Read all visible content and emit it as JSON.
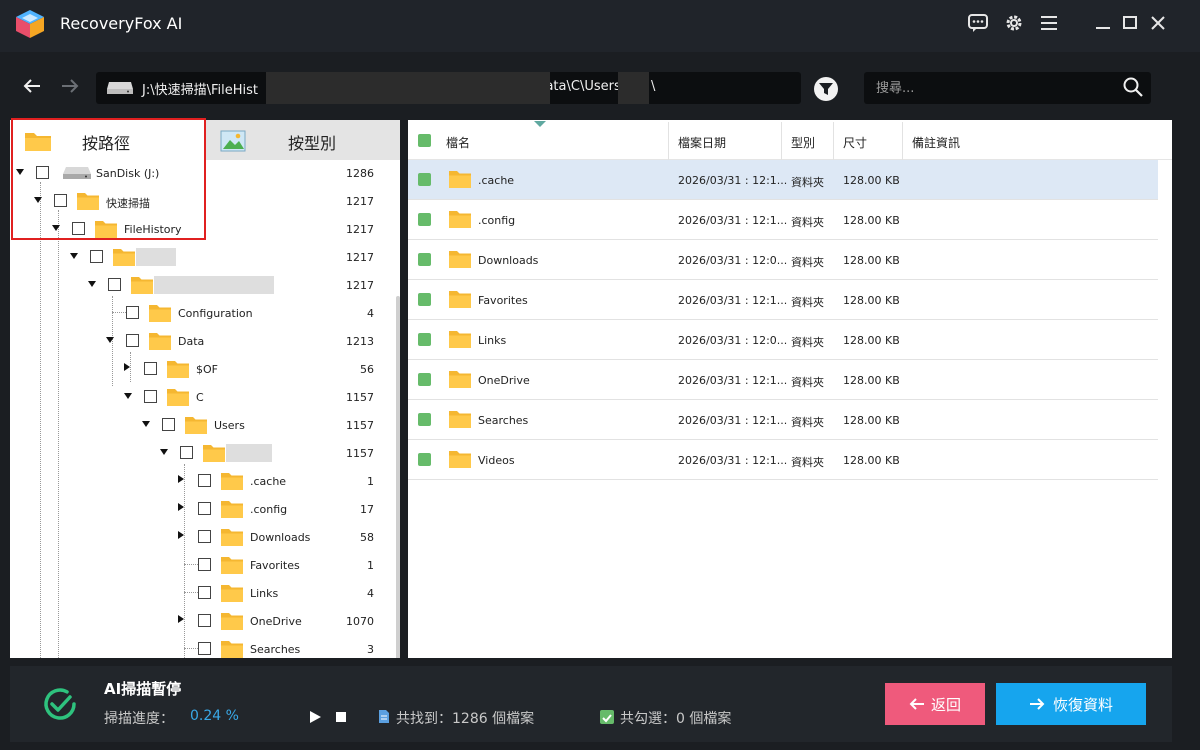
{
  "app": {
    "title": "RecoveryFox AI"
  },
  "address": {
    "path_prefix": "J:\\快速掃描\\FileHist",
    "path_suffix": ")\\Data\\C\\Users\\",
    "path_tail": "\\",
    "search_placeholder": "搜尋..."
  },
  "tabs": {
    "by_path": "按路徑",
    "by_type": "按型別"
  },
  "tree": [
    {
      "label": "SanDisk (J:)",
      "count": "1286"
    },
    {
      "label": "快速掃描",
      "count": "1217"
    },
    {
      "label": "FileHistory",
      "count": "1217"
    },
    {
      "label": "",
      "count": "1217"
    },
    {
      "label": "",
      "count": "1217"
    },
    {
      "label": "Configuration",
      "count": "4"
    },
    {
      "label": "Data",
      "count": "1213"
    },
    {
      "label": "$OF",
      "count": "56"
    },
    {
      "label": "C",
      "count": "1157"
    },
    {
      "label": "Users",
      "count": "1157"
    },
    {
      "label": "",
      "count": "1157"
    },
    {
      "label": ".cache",
      "count": "1"
    },
    {
      "label": ".config",
      "count": "17"
    },
    {
      "label": "Downloads",
      "count": "58"
    },
    {
      "label": "Favorites",
      "count": "1"
    },
    {
      "label": "Links",
      "count": "4"
    },
    {
      "label": "OneDrive",
      "count": "1070"
    },
    {
      "label": "Searches",
      "count": "3"
    }
  ],
  "table": {
    "columns": [
      "檔名",
      "檔案日期",
      "型別",
      "尺寸",
      "備註資訊"
    ],
    "rows": [
      {
        "name": ".cache",
        "date": "2026/03/31 : 12:1...",
        "type": "資料夾",
        "size": "128.00 KB"
      },
      {
        "name": ".config",
        "date": "2026/03/31 : 12:1...",
        "type": "資料夾",
        "size": "128.00 KB"
      },
      {
        "name": "Downloads",
        "date": "2026/03/31 : 12:0...",
        "type": "資料夾",
        "size": "128.00 KB"
      },
      {
        "name": "Favorites",
        "date": "2026/03/31 : 12:1...",
        "type": "資料夾",
        "size": "128.00 KB"
      },
      {
        "name": "Links",
        "date": "2026/03/31 : 12:0...",
        "type": "資料夾",
        "size": "128.00 KB"
      },
      {
        "name": "OneDrive",
        "date": "2026/03/31 : 12:1...",
        "type": "資料夾",
        "size": "128.00 KB"
      },
      {
        "name": "Searches",
        "date": "2026/03/31 : 12:1...",
        "type": "資料夾",
        "size": "128.00 KB"
      },
      {
        "name": "Videos",
        "date": "2026/03/31 : 12:1...",
        "type": "資料夾",
        "size": "128.00 KB"
      }
    ]
  },
  "status": {
    "title": "AI掃描暫停",
    "progress_label": "掃描進度：",
    "progress_value": "0.24 %",
    "found": "共找到：1286 個檔案",
    "checked": "共勾選：0 個檔案"
  },
  "buttons": {
    "back": "返回",
    "recover": "恢復資料"
  },
  "colors": {
    "accent_blue": "#16a5ee",
    "back_pink": "#ef5a7c",
    "check_green": "#66bb6a",
    "progress_blue": "#39a9e8",
    "folder_yellow": "#f5b731"
  }
}
